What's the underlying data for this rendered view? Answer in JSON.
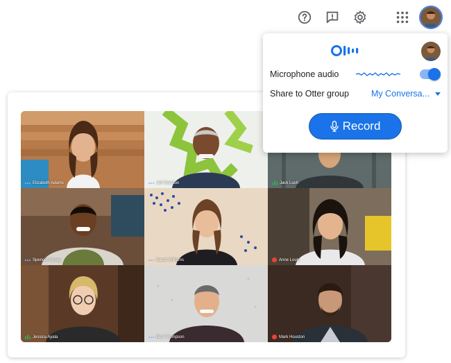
{
  "toolbar": {
    "icons": [
      "help-icon",
      "feedback-icon",
      "settings-icon",
      "apps-grid-icon"
    ]
  },
  "otter": {
    "logo": "Otter",
    "mic_label": "Microphone audio",
    "mic_enabled": true,
    "share_label": "Share to Otter group",
    "group_value": "My Conversa...",
    "record_label": "Record",
    "accent": "#1a73e8"
  },
  "participants": [
    {
      "name": "Elizabeth Adams",
      "mic": "dots"
    },
    {
      "name": "Jeff Sheldon",
      "mic": "dots"
    },
    {
      "name": "Jack Lush",
      "mic": "bars"
    },
    {
      "name": "Spencer Kooey",
      "mic": "dots"
    },
    {
      "name": "Sarah Williams",
      "mic": "dots"
    },
    {
      "name": "Anne Louis",
      "mic": "muted"
    },
    {
      "name": "Jessica Ayala",
      "mic": "bars"
    },
    {
      "name": "Ben Thompson",
      "mic": "dots"
    },
    {
      "name": "Mark Houston",
      "mic": "muted"
    }
  ]
}
